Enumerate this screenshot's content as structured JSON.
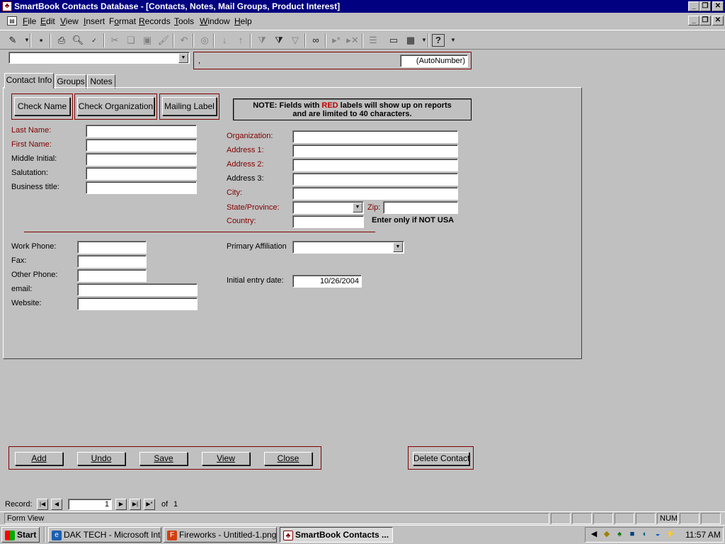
{
  "window": {
    "title": "SmartBook Contacts Database - [Contacts, Notes, Mail Groups, Product Interest]"
  },
  "menu": {
    "items": [
      {
        "label": "File",
        "accel": "F"
      },
      {
        "label": "Edit",
        "accel": "E"
      },
      {
        "label": "View",
        "accel": "V"
      },
      {
        "label": "Insert",
        "accel": "I"
      },
      {
        "label": "Format",
        "accel": "o"
      },
      {
        "label": "Records",
        "accel": "R"
      },
      {
        "label": "Tools",
        "accel": "T"
      },
      {
        "label": "Window",
        "accel": "W"
      },
      {
        "label": "Help",
        "accel": "H"
      }
    ]
  },
  "toolbar": {
    "icons": [
      "design-view-icon",
      "save-icon",
      "print-icon",
      "print-preview-icon",
      "spelling-icon",
      "cut-icon",
      "copy-icon",
      "paste-icon",
      "format-painter-icon",
      "undo-icon",
      "insert-hyperlink-icon",
      "sort-ascending-icon",
      "sort-descending-icon",
      "filter-by-selection-icon",
      "filter-by-form-icon",
      "apply-filter-icon",
      "find-icon",
      "new-record-icon",
      "delete-record-icon",
      "properties-icon",
      "database-window-icon",
      "new-object-icon",
      "help-icon"
    ]
  },
  "header": {
    "lookup_value": "",
    "id_prefix": ",",
    "autonumber": "(AutoNumber)"
  },
  "tabs": [
    {
      "label": "Contact Info",
      "active": true
    },
    {
      "label": "Groups",
      "active": false
    },
    {
      "label": "Notes",
      "active": false
    }
  ],
  "actions": {
    "check_name": "Check Name",
    "check_org": "Check Organization",
    "mailing_label": "Mailing Label"
  },
  "note": {
    "prefix": "NOTE:  Fields with ",
    "red_word": "RED",
    "suffix": " labels will show up on reports",
    "line2": "and are limited to 40 characters."
  },
  "person": {
    "last_name": {
      "label": "Last Name:",
      "value": ""
    },
    "first_name": {
      "label": "First Name:",
      "value": ""
    },
    "middle_initial": {
      "label": "Middle Initial:",
      "value": ""
    },
    "salutation": {
      "label": "Salutation:",
      "value": ""
    },
    "business_title": {
      "label": "Business  title:",
      "value": ""
    }
  },
  "org": {
    "organization": {
      "label": "Organization:",
      "value": ""
    },
    "address1": {
      "label": "Address 1:",
      "value": ""
    },
    "address2": {
      "label": "Address 2:",
      "value": ""
    },
    "address3": {
      "label": "Address 3:",
      "value": ""
    },
    "city": {
      "label": "City:",
      "value": ""
    },
    "state": {
      "label": "State/Province:",
      "value": ""
    },
    "zip": {
      "label": "Zip:",
      "value": ""
    },
    "country": {
      "label": "Country:",
      "value": ""
    },
    "country_hint": "Enter only if NOT USA"
  },
  "contact": {
    "work_phone": {
      "label": "Work Phone:",
      "value": ""
    },
    "fax": {
      "label": "Fax:",
      "value": ""
    },
    "other_phone": {
      "label": "Other Phone:",
      "value": ""
    },
    "email": {
      "label": "email:",
      "value": ""
    },
    "website": {
      "label": "Website:",
      "value": ""
    }
  },
  "misc": {
    "primary_affiliation": {
      "label": "Primary Affiliation",
      "value": ""
    },
    "initial_entry": {
      "label": "Initial entry date:",
      "value": "10/26/2004"
    }
  },
  "bottom_buttons": {
    "add": "Add",
    "undo": "Undo",
    "save": "Save",
    "view": "View",
    "close": "Close",
    "delete": "Delete Contact"
  },
  "record_nav": {
    "label": "Record:",
    "current": "1",
    "of_label": "of",
    "total": "1"
  },
  "status": {
    "text": "Form View",
    "num": "NUM"
  },
  "taskbar": {
    "start": "Start",
    "tasks": [
      {
        "label": "DAK TECH - Microsoft Inte..."
      },
      {
        "label": "Fireworks - Untitled-1.png"
      },
      {
        "label": "SmartBook Contacts ..."
      }
    ],
    "clock": "11:57 AM"
  },
  "colors": {
    "titlebar": "#000080",
    "required_label": "#800000",
    "note_red": "#c00000"
  }
}
